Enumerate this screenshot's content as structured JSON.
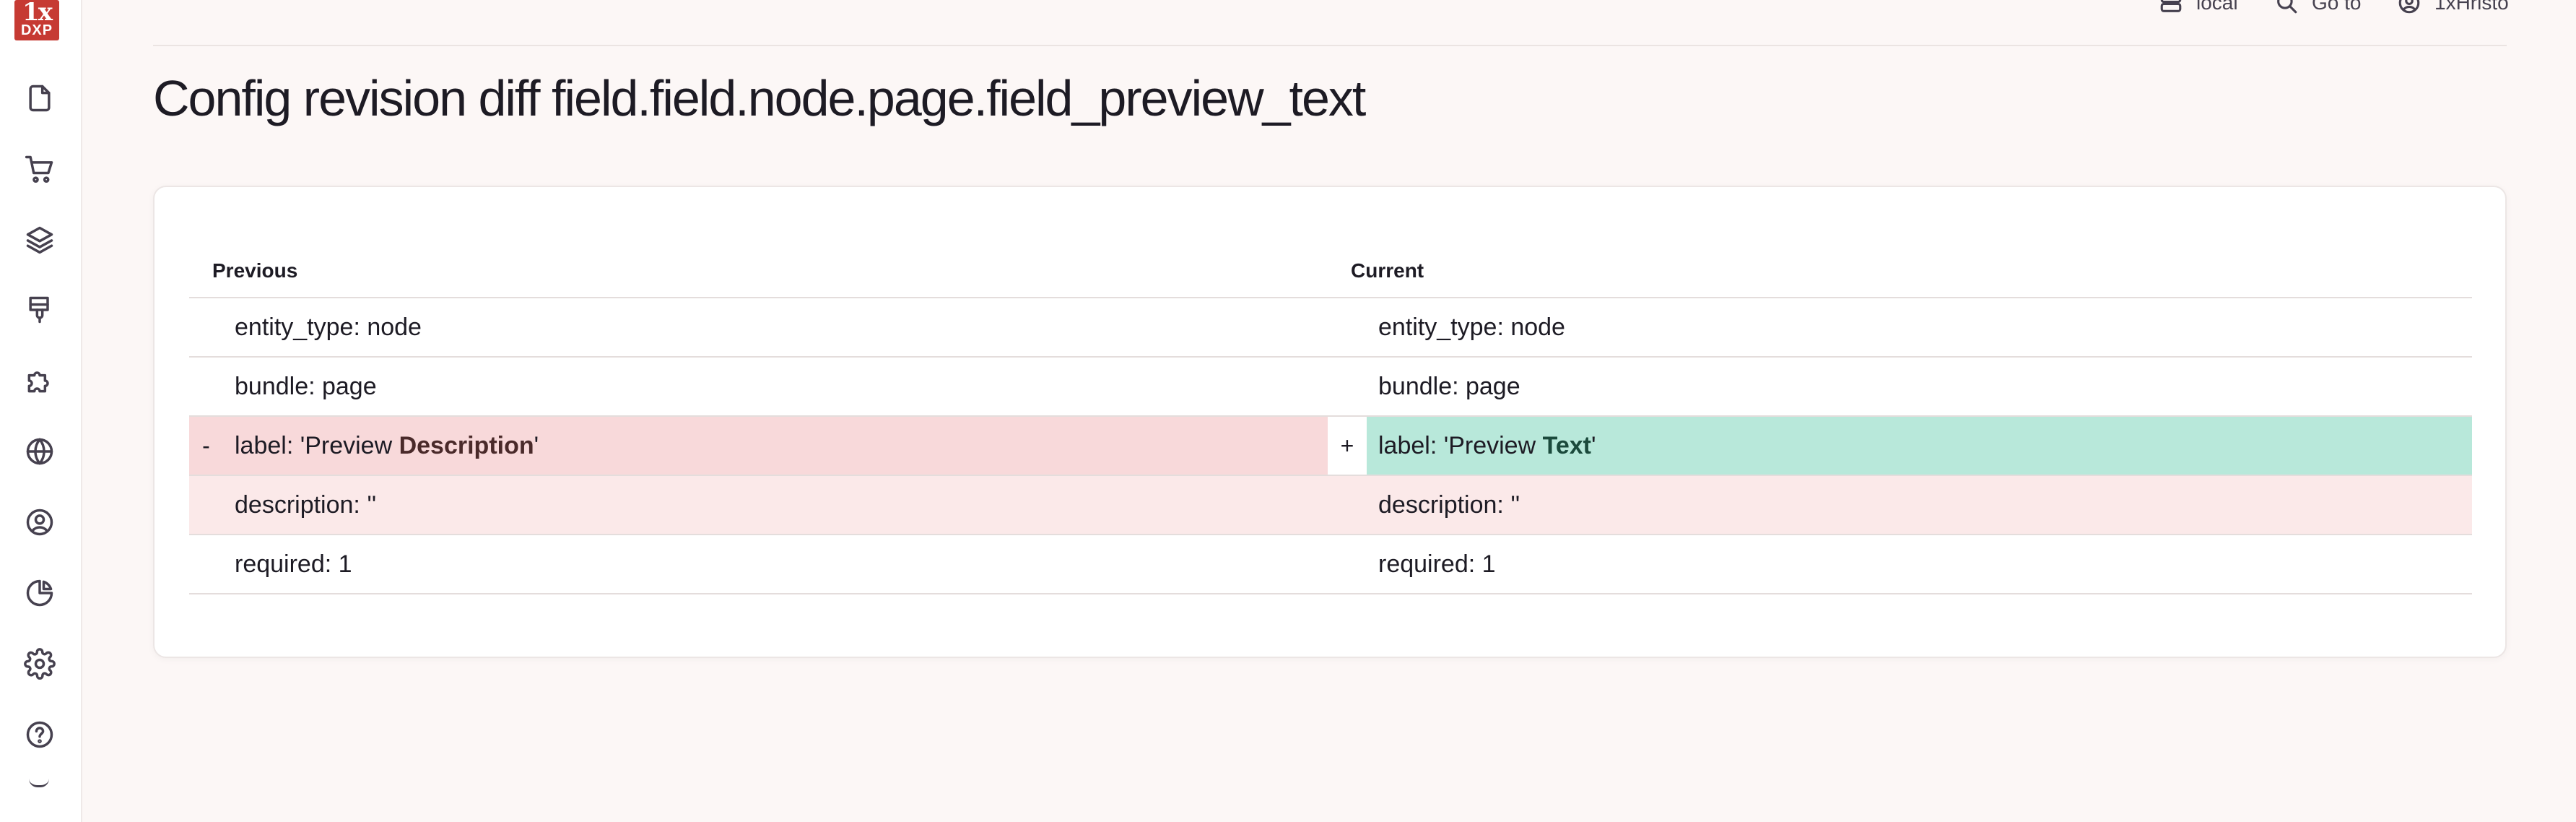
{
  "logo": {
    "top": "1x",
    "bottom": "DXP"
  },
  "sidebar": {
    "icons": [
      "document-icon",
      "cart-icon",
      "layers-icon",
      "paint-brush-icon",
      "puzzle-icon",
      "globe-icon",
      "user-circle-icon",
      "pie-chart-icon",
      "gear-icon",
      "help-icon"
    ]
  },
  "topbar": {
    "environment": "local",
    "goto": "Go to",
    "user": "1xHristo"
  },
  "page": {
    "title": "Config revision diff field.field.node.page.field_preview_text"
  },
  "diff": {
    "previous_label": "Previous",
    "current_label": "Current",
    "rows": [
      {
        "left": "entity_type: node",
        "right": "entity_type: node"
      },
      {
        "left": "bundle: page",
        "right": "bundle: page"
      },
      {
        "left_marker": "-",
        "left_prefix": "label: 'Preview ",
        "left_changed": "Description",
        "left_suffix": "'",
        "right_marker": "+",
        "right_prefix": "label: 'Preview ",
        "right_changed": "Text",
        "right_suffix": "'"
      },
      {
        "left": "description: ''",
        "right": "description: ''"
      },
      {
        "left": "required: 1",
        "right": "required: 1"
      }
    ]
  },
  "colors": {
    "deleted_bg": "#f8d9da",
    "added_bg": "#b8e8da",
    "highlight_row_bg": "#fbe9e9",
    "logo_red": "#c63a33"
  }
}
